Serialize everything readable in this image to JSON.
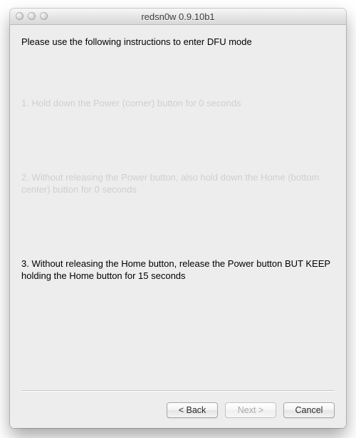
{
  "window": {
    "title": "redsn0w 0.9.10b1"
  },
  "content": {
    "heading": "Please use the following instructions to enter DFU mode",
    "step1": "1. Hold down the Power (corner) button for 0 seconds",
    "step2": "2. Without releasing the Power button, also hold down the Home (bottom center) button for 0 seconds",
    "step3": "3. Without releasing the Home button, release the Power button BUT KEEP holding the Home button for 15 seconds"
  },
  "buttons": {
    "back": "< Back",
    "next": "Next >",
    "cancel": "Cancel"
  }
}
